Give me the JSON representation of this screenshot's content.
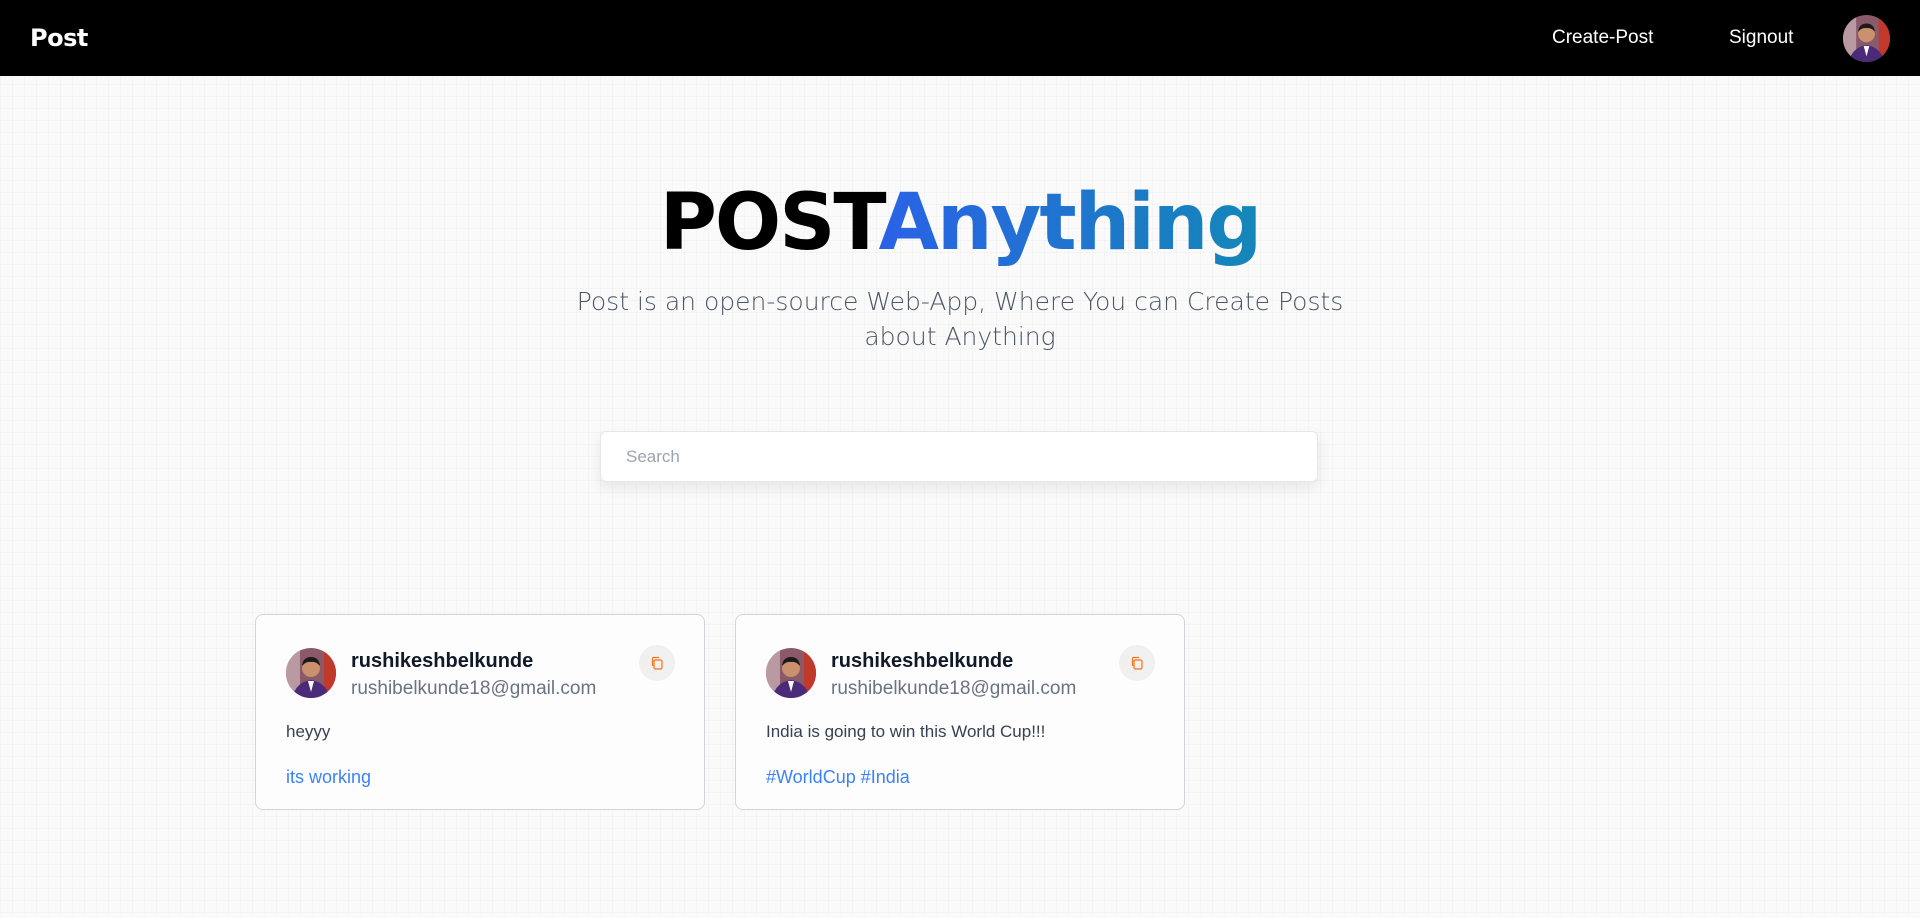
{
  "navbar": {
    "brand": "Post",
    "links": [
      {
        "label": "Create-Post"
      },
      {
        "label": "Signout"
      }
    ],
    "avatar_icon": "user-avatar-photo"
  },
  "hero": {
    "title_part1": "POST",
    "title_part2": "Anything",
    "subtitle": "Post is an open-source Web-App, Where You can Create Posts about Anything"
  },
  "search": {
    "placeholder": "Search",
    "value": ""
  },
  "posts": [
    {
      "username": "rushikeshbelkunde",
      "email": "rushibelkunde18@gmail.com",
      "content": "heyyy",
      "tags": "its working",
      "copy_icon": "copy-icon"
    },
    {
      "username": "rushikeshbelkunde",
      "email": "rushibelkunde18@gmail.com",
      "content": "India is going to win this World Cup!!!",
      "tags": "#WorldCup #India",
      "copy_icon": "copy-icon"
    }
  ],
  "colors": {
    "navbar_bg": "#000000",
    "accent_start": "#2a62e6",
    "accent_end": "#1487b8",
    "tag_color": "#3b82f6",
    "copy_icon_color": "#f97316"
  }
}
